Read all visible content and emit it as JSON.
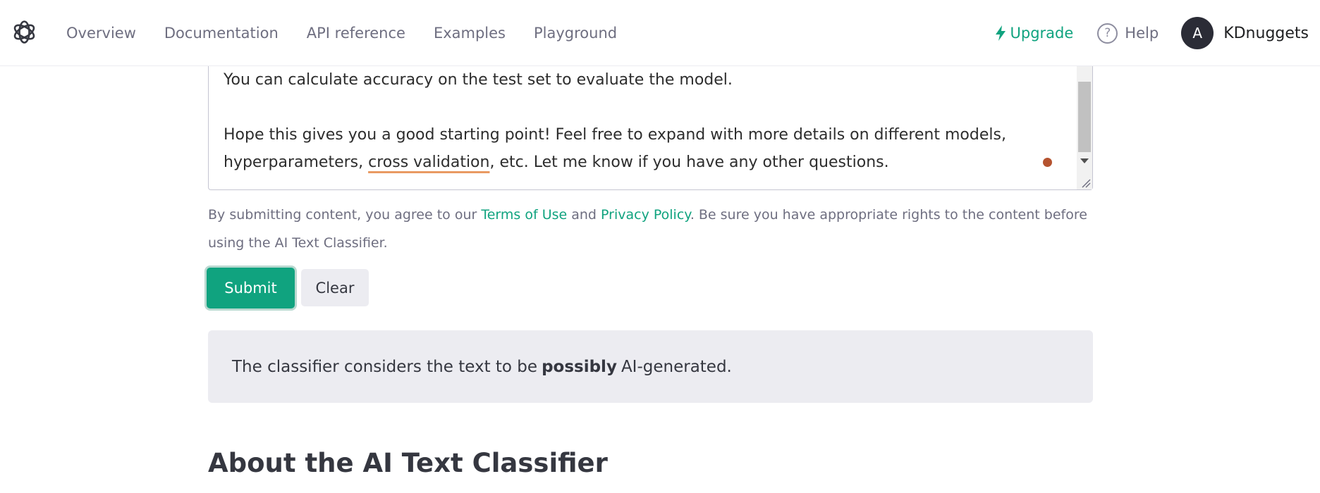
{
  "nav": {
    "links": [
      "Overview",
      "Documentation",
      "API reference",
      "Examples",
      "Playground"
    ],
    "upgrade_label": "Upgrade",
    "help_label": "Help",
    "help_icon_glyph": "?",
    "avatar_initial": "A",
    "account_name": "KDnuggets"
  },
  "textarea": {
    "line1": "You can calculate accuracy on the test set to evaluate the model.",
    "line2a": "Hope this gives you a good starting point! Feel free to expand with more details on different models,",
    "line3_pre": "hyperparameters, ",
    "line3_underlined": "cross validation",
    "line3_post": ", etc. Let me know if you have any other questions."
  },
  "terms": {
    "pre": "By submitting content, you agree to our ",
    "terms_link": "Terms of Use",
    "mid": " and ",
    "privacy_link": "Privacy Policy",
    "post": ". Be sure you have appropriate rights to the content before using the AI Text Classifier."
  },
  "buttons": {
    "submit": "Submit",
    "clear": "Clear"
  },
  "result": {
    "pre": "The classifier considers the text to be",
    "emphasis": "possibly",
    "post": "AI-generated."
  },
  "about_heading": "About the AI Text Classifier",
  "colors": {
    "accent": "#10a37f",
    "dot": "#b5532f",
    "underline": "#e99a62"
  }
}
